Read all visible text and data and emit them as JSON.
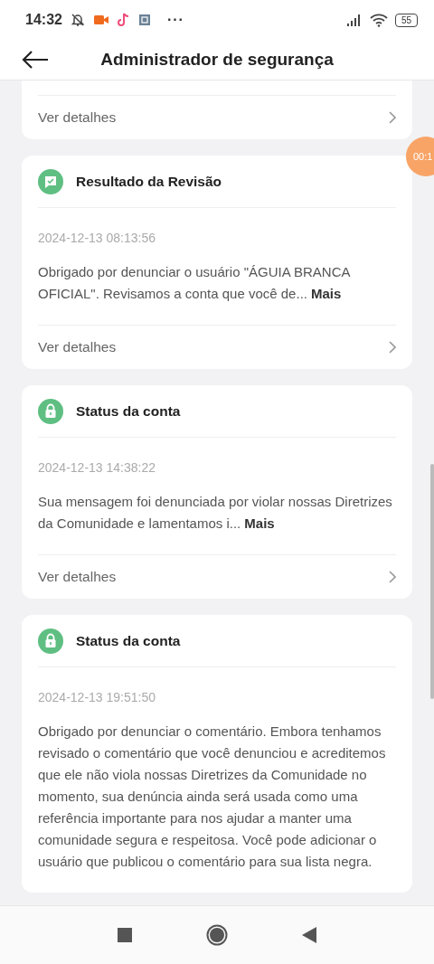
{
  "status_bar": {
    "time": "14:32",
    "more": "···",
    "battery": "55"
  },
  "header": {
    "title": "Administrador de segurança"
  },
  "floating_timer": "00:1",
  "cards": [
    {
      "kind": "partial",
      "details": "Ver detalhes"
    },
    {
      "kind": "review",
      "title": "Resultado da Revisão",
      "date": "2024-12-13 08:13:56",
      "message": "Obrigado por denunciar o usuário \"ÁGUIA BRANCA OFICIAL\". Revisamos a conta que você de...",
      "more": "Mais",
      "details": "Ver detalhes"
    },
    {
      "kind": "lock",
      "title": "Status da conta",
      "date": "2024-12-13 14:38:22",
      "message": "Sua mensagem foi denunciada por violar nossas Diretrizes da Comunidade e lamentamos i...",
      "more": "Mais",
      "details": "Ver detalhes"
    },
    {
      "kind": "lock",
      "title": "Status da conta",
      "date": "2024-12-13 19:51:50",
      "message": "Obrigado por denunciar o comentário. Embora tenhamos revisado o comentário que você denunciou e acreditemos que ele não viola nossas Diretrizes da Comunidade no momento, sua denúncia ainda será usada como uma referência importante para nos ajudar a manter uma comunidade segura e respeitosa. Você pode adicionar o usuário que publicou o comentário para sua lista negra."
    }
  ]
}
